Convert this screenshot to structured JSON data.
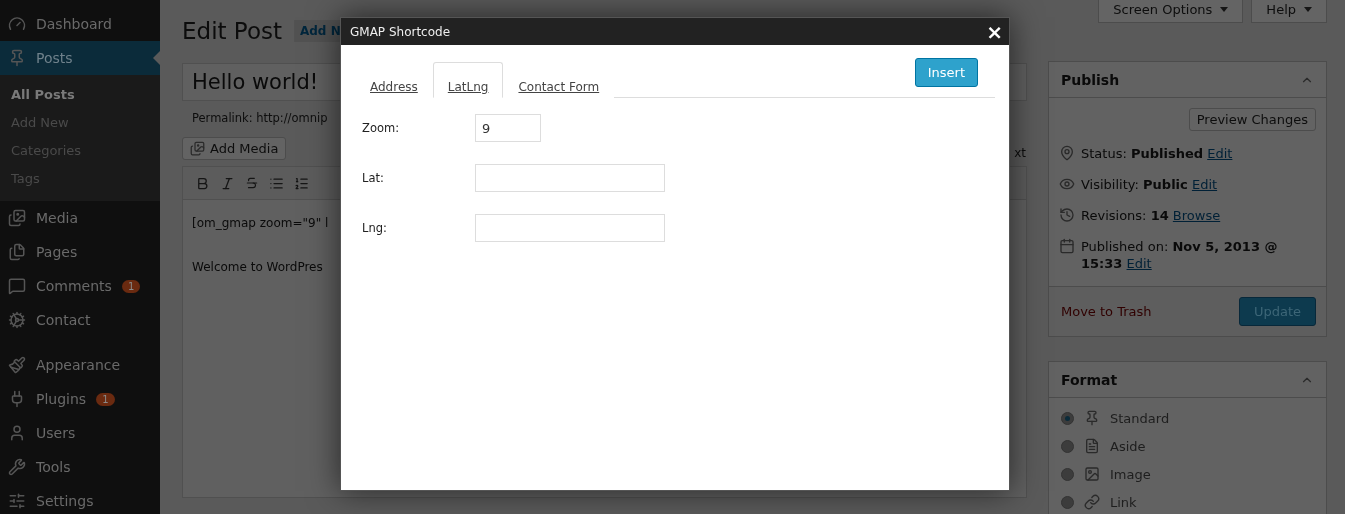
{
  "sidebar": {
    "items": [
      {
        "label": "Dashboard",
        "selected": false
      },
      {
        "label": "Posts",
        "selected": true,
        "children": [
          {
            "label": "All Posts",
            "selected": true
          },
          {
            "label": "Add New",
            "selected": false
          },
          {
            "label": "Categories",
            "selected": false
          },
          {
            "label": "Tags",
            "selected": false
          }
        ]
      },
      {
        "label": "Media",
        "selected": false
      },
      {
        "label": "Pages",
        "selected": false
      },
      {
        "label": "Comments",
        "selected": false,
        "badge": "1"
      },
      {
        "label": "Contact",
        "selected": false
      },
      {
        "label": "Appearance",
        "selected": false
      },
      {
        "label": "Plugins",
        "selected": false,
        "badge": "1"
      },
      {
        "label": "Users",
        "selected": false
      },
      {
        "label": "Tools",
        "selected": false
      },
      {
        "label": "Settings",
        "selected": false
      }
    ]
  },
  "header": {
    "title": "Edit Post",
    "add_new": "Add N",
    "screen_options": "Screen Options",
    "help": "Help"
  },
  "editor": {
    "post_title": "Hello world!",
    "permalink": "Permalink: http://omnip",
    "add_media": "Add Media",
    "text_tab": "xt",
    "content": [
      "[om_gmap zoom=\"9\" l",
      "Welcome to WordPres"
    ]
  },
  "publish": {
    "title": "Publish",
    "preview": "Preview Changes",
    "rows": [
      {
        "label": "Status: ",
        "value": "Published",
        "link": "Edit"
      },
      {
        "label": "Visibility: ",
        "value": "Public",
        "link": "Edit"
      },
      {
        "label": "Revisions: ",
        "value": "14",
        "link": "Browse"
      },
      {
        "label": "Published on: ",
        "value": "Nov 5, 2013 @ 15:33",
        "link": "Edit"
      }
    ],
    "trash": "Move to Trash",
    "update": "Update"
  },
  "format": {
    "title": "Format",
    "options": [
      {
        "label": "Standard",
        "selected": true
      },
      {
        "label": "Aside",
        "selected": false
      },
      {
        "label": "Image",
        "selected": false
      },
      {
        "label": "Link",
        "selected": false
      }
    ]
  },
  "modal": {
    "title": "GMAP Shortcode",
    "close": "×",
    "tabs": [
      {
        "label": "Address",
        "selected": false
      },
      {
        "label": "LatLng",
        "selected": true
      },
      {
        "label": "Contact Form",
        "selected": false
      }
    ],
    "insert": "Insert",
    "fields": [
      {
        "label": "Zoom:",
        "value": "9",
        "kind": "short"
      },
      {
        "label": "Lat:",
        "kind": "long"
      },
      {
        "label": "Lng:",
        "kind": "long"
      }
    ]
  }
}
